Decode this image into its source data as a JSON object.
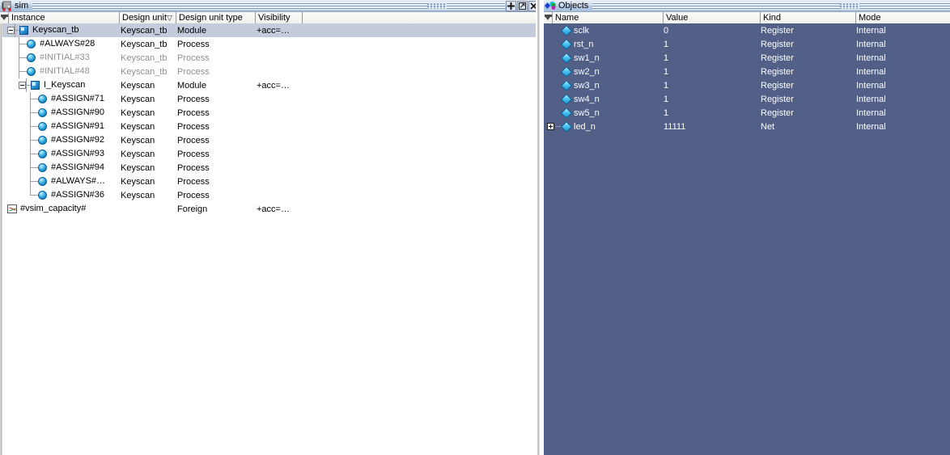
{
  "sim_panel": {
    "title": "sim",
    "icon": "library-structure-icon",
    "titlebar_buttons": [
      {
        "name": "move-button",
        "glyph": "+"
      },
      {
        "name": "undock-button",
        "glyph": "❐"
      },
      {
        "name": "close-button",
        "glyph": "✕"
      }
    ],
    "columns": [
      {
        "label": "Instance",
        "sorted": false
      },
      {
        "label": "Design unit",
        "sorted": true,
        "sort_glyph": "▽"
      },
      {
        "label": "Design unit type",
        "sorted": false
      },
      {
        "label": "Visibility",
        "sorted": false
      }
    ],
    "rows": [
      {
        "instance": "Keyscan_tb",
        "design_unit": "Keyscan_tb",
        "type": "Module",
        "visibility": "+acc=…",
        "depth": 0,
        "icon": "module-icon",
        "expander": "minus",
        "selected": true,
        "dim": false
      },
      {
        "instance": "#ALWAYS#28",
        "design_unit": "Keyscan_tb",
        "type": "Process",
        "visibility": "",
        "depth": 1,
        "icon": "process-icon",
        "expander": "none",
        "selected": false,
        "dim": false
      },
      {
        "instance": "#INITIAL#33",
        "design_unit": "Keyscan_tb",
        "type": "Process",
        "visibility": "",
        "depth": 1,
        "icon": "process-icon",
        "expander": "none",
        "selected": false,
        "dim": true
      },
      {
        "instance": "#INITIAL#48",
        "design_unit": "Keyscan_tb",
        "type": "Process",
        "visibility": "",
        "depth": 1,
        "icon": "process-icon",
        "expander": "none",
        "selected": false,
        "dim": true
      },
      {
        "instance": "I_Keyscan",
        "design_unit": "Keyscan",
        "type": "Module",
        "visibility": "+acc=…",
        "depth": 1,
        "icon": "module-icon",
        "expander": "minus",
        "selected": false,
        "dim": false
      },
      {
        "instance": "#ASSIGN#71",
        "design_unit": "Keyscan",
        "type": "Process",
        "visibility": "",
        "depth": 2,
        "icon": "process-icon",
        "expander": "none",
        "selected": false,
        "dim": false
      },
      {
        "instance": "#ASSIGN#90",
        "design_unit": "Keyscan",
        "type": "Process",
        "visibility": "",
        "depth": 2,
        "icon": "process-icon",
        "expander": "none",
        "selected": false,
        "dim": false
      },
      {
        "instance": "#ASSIGN#91",
        "design_unit": "Keyscan",
        "type": "Process",
        "visibility": "",
        "depth": 2,
        "icon": "process-icon",
        "expander": "none",
        "selected": false,
        "dim": false
      },
      {
        "instance": "#ASSIGN#92",
        "design_unit": "Keyscan",
        "type": "Process",
        "visibility": "",
        "depth": 2,
        "icon": "process-icon",
        "expander": "none",
        "selected": false,
        "dim": false
      },
      {
        "instance": "#ASSIGN#93",
        "design_unit": "Keyscan",
        "type": "Process",
        "visibility": "",
        "depth": 2,
        "icon": "process-icon",
        "expander": "none",
        "selected": false,
        "dim": false
      },
      {
        "instance": "#ASSIGN#94",
        "design_unit": "Keyscan",
        "type": "Process",
        "visibility": "",
        "depth": 2,
        "icon": "process-icon",
        "expander": "none",
        "selected": false,
        "dim": false
      },
      {
        "instance": "#ALWAYS#…",
        "design_unit": "Keyscan",
        "type": "Process",
        "visibility": "",
        "depth": 2,
        "icon": "process-icon",
        "expander": "none",
        "selected": false,
        "dim": false
      },
      {
        "instance": "#ASSIGN#36",
        "design_unit": "Keyscan",
        "type": "Process",
        "visibility": "",
        "depth": 2,
        "icon": "process-icon",
        "expander": "none",
        "selected": false,
        "dim": false
      },
      {
        "instance": "#vsim_capacity#",
        "design_unit": "",
        "type": "Foreign",
        "visibility": "+acc=…",
        "depth": 0,
        "icon": "foreign-icon",
        "expander": "none",
        "selected": false,
        "dim": false
      }
    ]
  },
  "objects_panel": {
    "title": "Objects",
    "icon": "objects-shapes-icon",
    "columns": [
      {
        "label": "Name"
      },
      {
        "label": "Value"
      },
      {
        "label": "Kind"
      },
      {
        "label": "Mode"
      }
    ],
    "rows": [
      {
        "name": "sclk",
        "value": "0",
        "kind": "Register",
        "mode": "Internal",
        "icon": "signal-diamond-icon",
        "expander": "none"
      },
      {
        "name": "rst_n",
        "value": "1",
        "kind": "Register",
        "mode": "Internal",
        "icon": "signal-diamond-icon",
        "expander": "none"
      },
      {
        "name": "sw1_n",
        "value": "1",
        "kind": "Register",
        "mode": "Internal",
        "icon": "signal-diamond-icon",
        "expander": "none"
      },
      {
        "name": "sw2_n",
        "value": "1",
        "kind": "Register",
        "mode": "Internal",
        "icon": "signal-diamond-icon",
        "expander": "none"
      },
      {
        "name": "sw3_n",
        "value": "1",
        "kind": "Register",
        "mode": "Internal",
        "icon": "signal-diamond-icon",
        "expander": "none"
      },
      {
        "name": "sw4_n",
        "value": "1",
        "kind": "Register",
        "mode": "Internal",
        "icon": "signal-diamond-icon",
        "expander": "none"
      },
      {
        "name": "sw5_n",
        "value": "1",
        "kind": "Register",
        "mode": "Internal",
        "icon": "signal-diamond-icon",
        "expander": "none"
      },
      {
        "name": "led_n",
        "value": "11111",
        "kind": "Net",
        "mode": "Internal",
        "icon": "signal-diamond-icon",
        "expander": "plus"
      }
    ]
  },
  "colors": {
    "sim_background": "#ffffff",
    "objects_background": "#525f87",
    "selection": "#c3cbdc",
    "header": "#f1f1ee",
    "titlebar": "#b9cce4",
    "dim_text": "#8f8f8f"
  }
}
